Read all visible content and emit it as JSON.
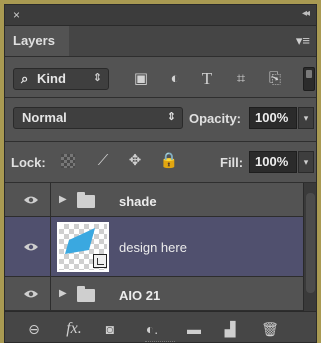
{
  "window": {
    "close_glyph": "×",
    "collapse_glyph": "◂◂"
  },
  "tab": {
    "label": "Layers",
    "menu_glyph": "▾≡"
  },
  "filter": {
    "kind_label": "Kind",
    "kind_icon": "⌕",
    "dropdown_glyph": "⇕",
    "tools": [
      {
        "name": "image-filter-icon",
        "glyph": "▣"
      },
      {
        "name": "adjustment-filter-icon",
        "glyph": "◐"
      },
      {
        "name": "type-filter-icon",
        "glyph": "T"
      },
      {
        "name": "shape-filter-icon",
        "glyph": "⌗"
      },
      {
        "name": "smart-object-filter-icon",
        "glyph": "⎘"
      }
    ]
  },
  "blend": {
    "mode": "Normal",
    "dropdown_glyph": "⇕",
    "opacity_label": "Opacity:",
    "opacity_value": "100%",
    "stepper_glyph": "▾"
  },
  "lock": {
    "label": "Lock:",
    "fill_label": "Fill:",
    "fill_value": "100%",
    "stepper_glyph": "▾"
  },
  "layers": [
    {
      "name": "shade",
      "type": "group",
      "twisty": "▶"
    },
    {
      "name": "design here",
      "type": "smart-object",
      "selected": true
    },
    {
      "name": "AIO 21",
      "type": "group",
      "twisty": "▶"
    }
  ],
  "bottom_tools": [
    {
      "name": "link-layers-icon",
      "glyph": "⊖"
    },
    {
      "name": "fx-icon",
      "glyph": "fx."
    },
    {
      "name": "add-mask-icon",
      "glyph": "◙"
    },
    {
      "name": "new-adjustment-icon",
      "glyph": "◐."
    },
    {
      "name": "new-group-icon",
      "glyph": "▬"
    },
    {
      "name": "new-layer-icon",
      "glyph": "▟"
    },
    {
      "name": "delete-layer-icon",
      "glyph": "🗑"
    }
  ],
  "colors": {
    "panel": "#535353",
    "selected": "#50506e",
    "accent": "#3aa8e0"
  }
}
